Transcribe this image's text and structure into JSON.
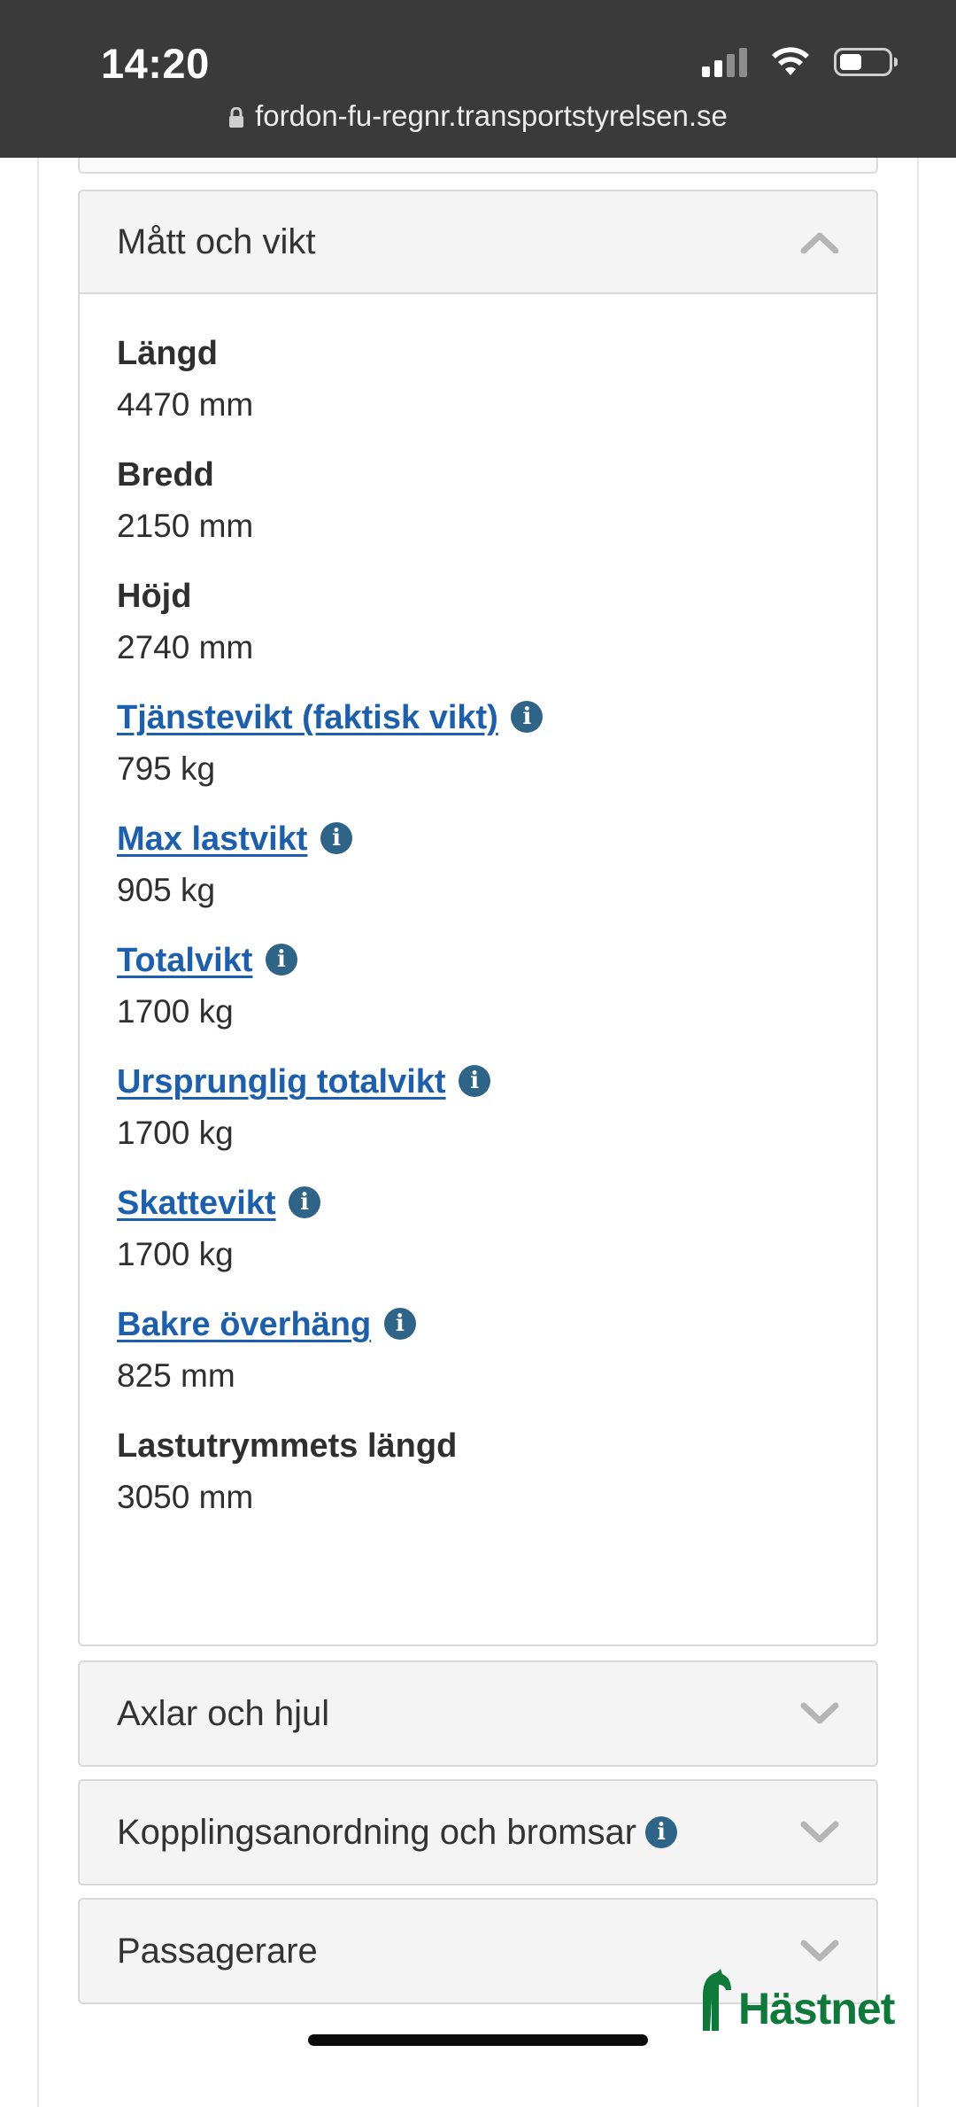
{
  "status_bar": {
    "time": "14:20"
  },
  "browser": {
    "url": "fordon-fu-regnr.transportstyrelsen.se"
  },
  "sections": {
    "matt_och_vikt": {
      "title": "Mått och vikt",
      "fields": [
        {
          "label": "Längd",
          "value": "4470 mm",
          "is_link": false,
          "has_info": false
        },
        {
          "label": "Bredd",
          "value": "2150 mm",
          "is_link": false,
          "has_info": false
        },
        {
          "label": "Höjd",
          "value": "2740 mm",
          "is_link": false,
          "has_info": false
        },
        {
          "label": "Tjänstevikt (faktisk vikt)",
          "value": "795 kg",
          "is_link": true,
          "has_info": true
        },
        {
          "label": "Max lastvikt",
          "value": "905 kg",
          "is_link": true,
          "has_info": true
        },
        {
          "label": "Totalvikt",
          "value": "1700 kg",
          "is_link": true,
          "has_info": true
        },
        {
          "label": "Ursprunglig totalvikt",
          "value": "1700 kg",
          "is_link": true,
          "has_info": true
        },
        {
          "label": "Skattevikt",
          "value": "1700 kg",
          "is_link": true,
          "has_info": true
        },
        {
          "label": "Bakre överhäng",
          "value": "825 mm",
          "is_link": true,
          "has_info": true
        },
        {
          "label": "Lastutrymmets längd",
          "value": "3050 mm",
          "is_link": false,
          "has_info": false
        }
      ]
    },
    "axlar_och_hjul": {
      "title": "Axlar och hjul"
    },
    "kopplingsanordning": {
      "title": "Kopplingsanordning och bromsar"
    },
    "passagerare": {
      "title": "Passagerare"
    }
  },
  "info_glyph": "i",
  "logo": {
    "text": "Hästnet"
  },
  "colors": {
    "link": "#1b5fae",
    "info_icon": "#2e6487",
    "logo": "#0d7a3a",
    "header_bg": "#f4f4f4"
  }
}
